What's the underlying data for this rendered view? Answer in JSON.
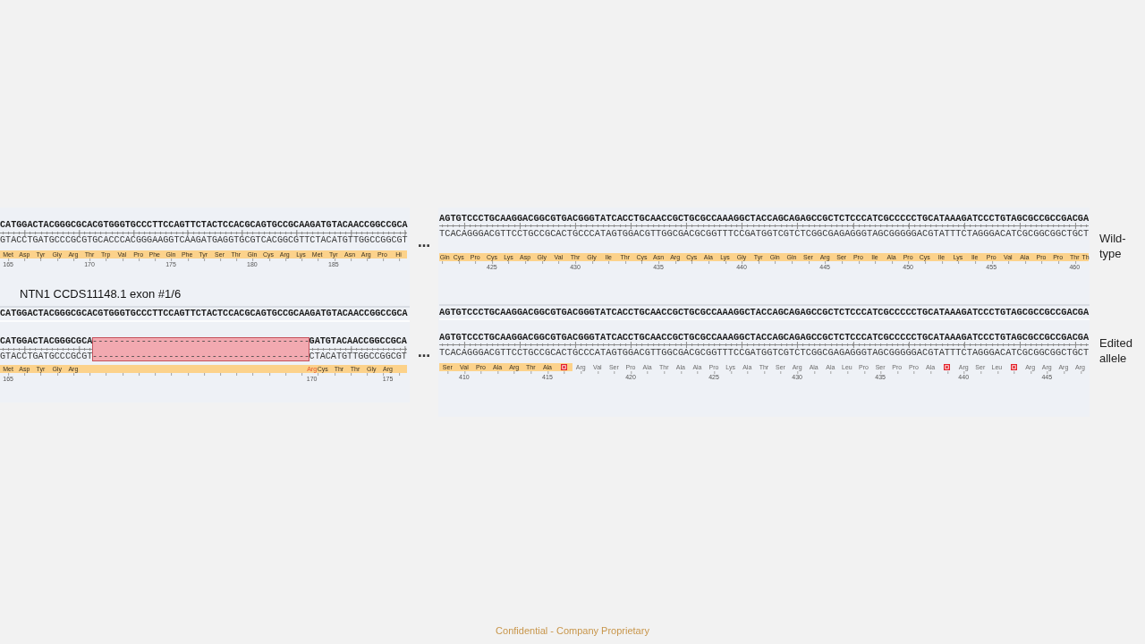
{
  "caption": "NTN1 CCDS11148.1 exon #1/6",
  "views": [
    {
      "tracks": [
        {
          "top_strand": [
            {
              "kind": "bases",
              "text": "CATGGACTACGGGCGCACGTGGGTGCCCTTCCAGTTCTACTCCACGCAGTGCCGCAAGATGTACAACCGGCCGCA"
            }
          ],
          "bottom_strand": [
            {
              "kind": "bases",
              "text": "GTACCTGATGCCCGCGTGCACCCACGGGAAGGTCAAGATGAGGTGCGTCACGGCGTTCTACATGTTGGCCGGCGT"
            }
          ],
          "translation": {
            "segments": [
              {
                "kind": "feature",
                "residues": [
                  {
                    "kind": "amino_acid",
                    "label": "Met",
                    "number": "165",
                    "changed": false
                  },
                  {
                    "kind": "amino_acid",
                    "label": "Asp",
                    "changed": false
                  },
                  {
                    "kind": "amino_acid",
                    "label": "Tyr",
                    "changed": false
                  },
                  {
                    "kind": "amino_acid",
                    "label": "Gly",
                    "changed": false
                  },
                  {
                    "kind": "amino_acid",
                    "label": "Arg",
                    "changed": false
                  },
                  {
                    "kind": "amino_acid",
                    "label": "Thr",
                    "number": "170",
                    "changed": false
                  },
                  {
                    "kind": "amino_acid",
                    "label": "Trp",
                    "changed": false
                  },
                  {
                    "kind": "amino_acid",
                    "label": "Val",
                    "changed": false
                  },
                  {
                    "kind": "amino_acid",
                    "label": "Pro",
                    "changed": false
                  },
                  {
                    "kind": "amino_acid",
                    "label": "Phe",
                    "changed": false
                  },
                  {
                    "kind": "amino_acid",
                    "label": "Gln",
                    "number": "175",
                    "changed": false
                  },
                  {
                    "kind": "amino_acid",
                    "label": "Phe",
                    "changed": false
                  },
                  {
                    "kind": "amino_acid",
                    "label": "Tyr",
                    "changed": false
                  },
                  {
                    "kind": "amino_acid",
                    "label": "Ser",
                    "changed": false
                  },
                  {
                    "kind": "amino_acid",
                    "label": "Thr",
                    "changed": false
                  },
                  {
                    "kind": "amino_acid",
                    "label": "Gln",
                    "number": "180",
                    "changed": false
                  },
                  {
                    "kind": "amino_acid",
                    "label": "Cys",
                    "changed": false
                  },
                  {
                    "kind": "amino_acid",
                    "label": "Arg",
                    "changed": false
                  },
                  {
                    "kind": "amino_acid",
                    "label": "Lys",
                    "changed": false
                  },
                  {
                    "kind": "amino_acid",
                    "label": "Met",
                    "changed": false
                  },
                  {
                    "kind": "amino_acid",
                    "label": "Tyr",
                    "number": "185",
                    "changed": false
                  },
                  {
                    "kind": "amino_acid",
                    "label": "Asn",
                    "changed": false
                  },
                  {
                    "kind": "amino_acid",
                    "label": "Arg",
                    "changed": false
                  },
                  {
                    "kind": "amino_acid",
                    "label": "Pro",
                    "changed": false
                  },
                  {
                    "kind": "amino_acid",
                    "label": "Hi",
                    "changed": false
                  }
                ]
              }
            ]
          }
        },
        {
          "reference": "CATGGACTACGGGCGCACGTGGGTGCCCTTCCAGTTCTACTCCACGCAGTGCCGCAAGATGTACAACCGGCCGCA",
          "top_strand": [
            {
              "kind": "bases",
              "text": "CATGGACTACGGGCGCA"
            },
            {
              "kind": "deletion",
              "text": "----------------------------------------"
            },
            {
              "kind": "bases",
              "text": "GATGTACAACCGGCCGCA"
            }
          ],
          "bottom_strand": [
            {
              "kind": "bases",
              "text": "GTACCTGATGCCCGCGT"
            },
            {
              "kind": "deletion",
              "text": "----------------------------------------"
            },
            {
              "kind": "bases",
              "text": "CTACATGTTGGCCGGCGT"
            }
          ],
          "translation": {
            "segments": [
              {
                "kind": "feature",
                "residues": [
                  {
                    "kind": "amino_acid",
                    "label": "Met",
                    "number": "165",
                    "changed": false
                  },
                  {
                    "kind": "amino_acid",
                    "label": "Asp",
                    "changed": false
                  },
                  {
                    "kind": "amino_acid",
                    "label": "Tyr",
                    "changed": false
                  },
                  {
                    "kind": "amino_acid",
                    "label": "Gly",
                    "changed": false
                  },
                  {
                    "kind": "amino_acid",
                    "label": "Arg",
                    "changed": false
                  },
                  {
                    "kind": "amino_acid",
                    "label": "Arg",
                    "number": "170",
                    "changed": true
                  },
                  {
                    "kind": "amino_acid",
                    "label": "Cys",
                    "changed": false
                  },
                  {
                    "kind": "amino_acid",
                    "label": "Thr",
                    "changed": false
                  },
                  {
                    "kind": "amino_acid",
                    "label": "Thr",
                    "changed": false
                  },
                  {
                    "kind": "amino_acid",
                    "label": "Gly",
                    "changed": false
                  },
                  {
                    "kind": "amino_acid",
                    "label": "Arg",
                    "number": "175",
                    "changed": false
                  }
                ]
              }
            ]
          }
        }
      ]
    },
    {
      "tracks": [
        {
          "top_strand": [
            {
              "kind": "bases",
              "text": "AGTGTCCCTGCAAGGACGGCGTGACGGGTATCACCTGCAACCGCTGCGCCAAAGGCTACCAGCAGAGCCGCTCTCCCATCGCCCCCTGCATAAAGATCCCTGTAGCGCCGCCGACGA"
            }
          ],
          "bottom_strand": [
            {
              "kind": "bases",
              "text": "TCACAGGGACGTTCCTGCCGCACTGCCCATAGTGGACGTTGGCGACGCGGTTTCCGATGGTCGTCTCGGCGAGAGGGTAGCGGGGGACGTATTTCTAGGGACATCGCGGCGGCTGCT"
            }
          ],
          "translation": {
            "segments": [
              {
                "kind": "feature",
                "residues": [
                  {
                    "kind": "amino_acid",
                    "label": "Gln",
                    "changed": false
                  },
                  {
                    "kind": "amino_acid",
                    "label": "Cys",
                    "changed": false
                  },
                  {
                    "kind": "amino_acid",
                    "label": "Pro",
                    "changed": false
                  },
                  {
                    "kind": "amino_acid",
                    "label": "Cys",
                    "number": "425",
                    "changed": false
                  },
                  {
                    "kind": "amino_acid",
                    "label": "Lys",
                    "changed": false
                  },
                  {
                    "kind": "amino_acid",
                    "label": "Asp",
                    "changed": false
                  },
                  {
                    "kind": "amino_acid",
                    "label": "Gly",
                    "changed": false
                  },
                  {
                    "kind": "amino_acid",
                    "label": "Val",
                    "changed": false
                  },
                  {
                    "kind": "amino_acid",
                    "label": "Thr",
                    "number": "430",
                    "changed": false
                  },
                  {
                    "kind": "amino_acid",
                    "label": "Gly",
                    "changed": false
                  },
                  {
                    "kind": "amino_acid",
                    "label": "Ile",
                    "changed": false
                  },
                  {
                    "kind": "amino_acid",
                    "label": "Thr",
                    "changed": false
                  },
                  {
                    "kind": "amino_acid",
                    "label": "Cys",
                    "changed": false
                  },
                  {
                    "kind": "amino_acid",
                    "label": "Asn",
                    "number": "435",
                    "changed": false
                  },
                  {
                    "kind": "amino_acid",
                    "label": "Arg",
                    "changed": false
                  },
                  {
                    "kind": "amino_acid",
                    "label": "Cys",
                    "changed": false
                  },
                  {
                    "kind": "amino_acid",
                    "label": "Ala",
                    "changed": false
                  },
                  {
                    "kind": "amino_acid",
                    "label": "Lys",
                    "changed": false
                  },
                  {
                    "kind": "amino_acid",
                    "label": "Gly",
                    "number": "440",
                    "changed": false
                  },
                  {
                    "kind": "amino_acid",
                    "label": "Tyr",
                    "changed": false
                  },
                  {
                    "kind": "amino_acid",
                    "label": "Gln",
                    "changed": false
                  },
                  {
                    "kind": "amino_acid",
                    "label": "Gln",
                    "changed": false
                  },
                  {
                    "kind": "amino_acid",
                    "label": "Ser",
                    "changed": false
                  },
                  {
                    "kind": "amino_acid",
                    "label": "Arg",
                    "number": "445",
                    "changed": false
                  },
                  {
                    "kind": "amino_acid",
                    "label": "Ser",
                    "changed": false
                  },
                  {
                    "kind": "amino_acid",
                    "label": "Pro",
                    "changed": false
                  },
                  {
                    "kind": "amino_acid",
                    "label": "Ile",
                    "changed": false
                  },
                  {
                    "kind": "amino_acid",
                    "label": "Ala",
                    "changed": false
                  },
                  {
                    "kind": "amino_acid",
                    "label": "Pro",
                    "number": "450",
                    "changed": false
                  },
                  {
                    "kind": "amino_acid",
                    "label": "Cys",
                    "changed": false
                  },
                  {
                    "kind": "amino_acid",
                    "label": "Ile",
                    "changed": false
                  },
                  {
                    "kind": "amino_acid",
                    "label": "Lys",
                    "changed": false
                  },
                  {
                    "kind": "amino_acid",
                    "label": "Ile",
                    "changed": false
                  },
                  {
                    "kind": "amino_acid",
                    "label": "Pro",
                    "number": "455",
                    "changed": false
                  },
                  {
                    "kind": "amino_acid",
                    "label": "Val",
                    "changed": false
                  },
                  {
                    "kind": "amino_acid",
                    "label": "Ala",
                    "changed": false
                  },
                  {
                    "kind": "amino_acid",
                    "label": "Pro",
                    "changed": false
                  },
                  {
                    "kind": "amino_acid",
                    "label": "Pro",
                    "changed": false
                  },
                  {
                    "kind": "amino_acid",
                    "label": "Thr",
                    "number": "460",
                    "changed": false
                  },
                  {
                    "kind": "amino_acid",
                    "label": "Th",
                    "changed": false
                  }
                ]
              }
            ]
          }
        },
        {
          "reference": "AGTGTCCCTGCAAGGACGGCGTGACGGGTATCACCTGCAACCGCTGCGCCAAAGGCTACCAGCAGAGCCGCTCTCCCATCGCCCCCTGCATAAAGATCCCTGTAGCGCCGCCGACGA",
          "top_strand": [
            {
              "kind": "bases",
              "text": "AGTGTCCCTGCAAGGACGGCGTGACGGGTATCACCTGCAACCGCTGCGCCAAAGGCTACCAGCAGAGCCGCTCTCCCATCGCCCCCTGCATAAAGATCCCTGTAGCGCCGCCGACGA"
            }
          ],
          "bottom_strand": [
            {
              "kind": "bases",
              "text": "TCACAGGGACGTTCCTGCCGCACTGCCCATAGTGGACGTTGGCGACGCGGTTTCCGATGGTCGTCTCGGCGAGAGGGTAGCGGGGGACGTATTTCTAGGGACATCGCGGCGGCTGCT"
            }
          ],
          "translation": {
            "segments": [
              {
                "kind": "feature",
                "residues": [
                  {
                    "kind": "amino_acid",
                    "label": "Ser",
                    "changed": false
                  },
                  {
                    "kind": "amino_acid",
                    "label": "Val",
                    "number": "410",
                    "changed": false
                  },
                  {
                    "kind": "amino_acid",
                    "label": "Pro",
                    "changed": false
                  },
                  {
                    "kind": "amino_acid",
                    "label": "Ala",
                    "changed": false
                  },
                  {
                    "kind": "amino_acid",
                    "label": "Arg",
                    "changed": false
                  },
                  {
                    "kind": "amino_acid",
                    "label": "Thr",
                    "changed": false
                  },
                  {
                    "kind": "amino_acid",
                    "label": "Ala",
                    "number": "415",
                    "changed": false
                  },
                  {
                    "kind": "stop",
                    "changed": false
                  }
                ]
              },
              {
                "kind": "outside_feature",
                "residues": [
                  {
                    "kind": "amino_acid",
                    "label": "Arg",
                    "changed": false
                  },
                  {
                    "kind": "amino_acid",
                    "label": "Val",
                    "changed": false
                  },
                  {
                    "kind": "amino_acid",
                    "label": "Ser",
                    "changed": false
                  },
                  {
                    "kind": "amino_acid",
                    "label": "Pro",
                    "number": "420",
                    "changed": false
                  },
                  {
                    "kind": "amino_acid",
                    "label": "Ala",
                    "changed": false
                  },
                  {
                    "kind": "amino_acid",
                    "label": "Thr",
                    "changed": false
                  },
                  {
                    "kind": "amino_acid",
                    "label": "Ala",
                    "changed": false
                  },
                  {
                    "kind": "amino_acid",
                    "label": "Ala",
                    "changed": false
                  },
                  {
                    "kind": "amino_acid",
                    "label": "Pro",
                    "number": "425",
                    "changed": false
                  },
                  {
                    "kind": "amino_acid",
                    "label": "Lys",
                    "changed": false
                  },
                  {
                    "kind": "amino_acid",
                    "label": "Ala",
                    "changed": false
                  },
                  {
                    "kind": "amino_acid",
                    "label": "Thr",
                    "changed": false
                  },
                  {
                    "kind": "amino_acid",
                    "label": "Ser",
                    "changed": false
                  },
                  {
                    "kind": "amino_acid",
                    "label": "Arg",
                    "number": "430",
                    "changed": false
                  },
                  {
                    "kind": "amino_acid",
                    "label": "Ala",
                    "changed": false
                  },
                  {
                    "kind": "amino_acid",
                    "label": "Ala",
                    "changed": false
                  },
                  {
                    "kind": "amino_acid",
                    "label": "Leu",
                    "changed": false
                  },
                  {
                    "kind": "amino_acid",
                    "label": "Pro",
                    "changed": false
                  },
                  {
                    "kind": "amino_acid",
                    "label": "Ser",
                    "number": "435",
                    "changed": false
                  },
                  {
                    "kind": "amino_acid",
                    "label": "Pro",
                    "changed": false
                  },
                  {
                    "kind": "amino_acid",
                    "label": "Pro",
                    "changed": false
                  },
                  {
                    "kind": "amino_acid",
                    "label": "Ala",
                    "changed": false
                  },
                  {
                    "kind": "stop",
                    "changed": false
                  },
                  {
                    "kind": "amino_acid",
                    "label": "Arg",
                    "number": "440",
                    "changed": false
                  },
                  {
                    "kind": "amino_acid",
                    "label": "Ser",
                    "changed": false
                  },
                  {
                    "kind": "amino_acid",
                    "label": "Leu",
                    "changed": false
                  },
                  {
                    "kind": "stop",
                    "changed": false
                  },
                  {
                    "kind": "amino_acid",
                    "label": "Arg",
                    "changed": false
                  },
                  {
                    "kind": "amino_acid",
                    "label": "Arg",
                    "number": "445",
                    "changed": false
                  },
                  {
                    "kind": "amino_acid",
                    "label": "Arg",
                    "changed": false
                  },
                  {
                    "kind": "amino_acid",
                    "label": "Arg",
                    "changed": false
                  }
                ]
              }
            ]
          }
        }
      ]
    }
  ],
  "separators": [
    "…",
    "…"
  ],
  "row_labels": [
    "Wild-type",
    "Edited allele"
  ],
  "footer": "Confidential - Company Proprietary"
}
